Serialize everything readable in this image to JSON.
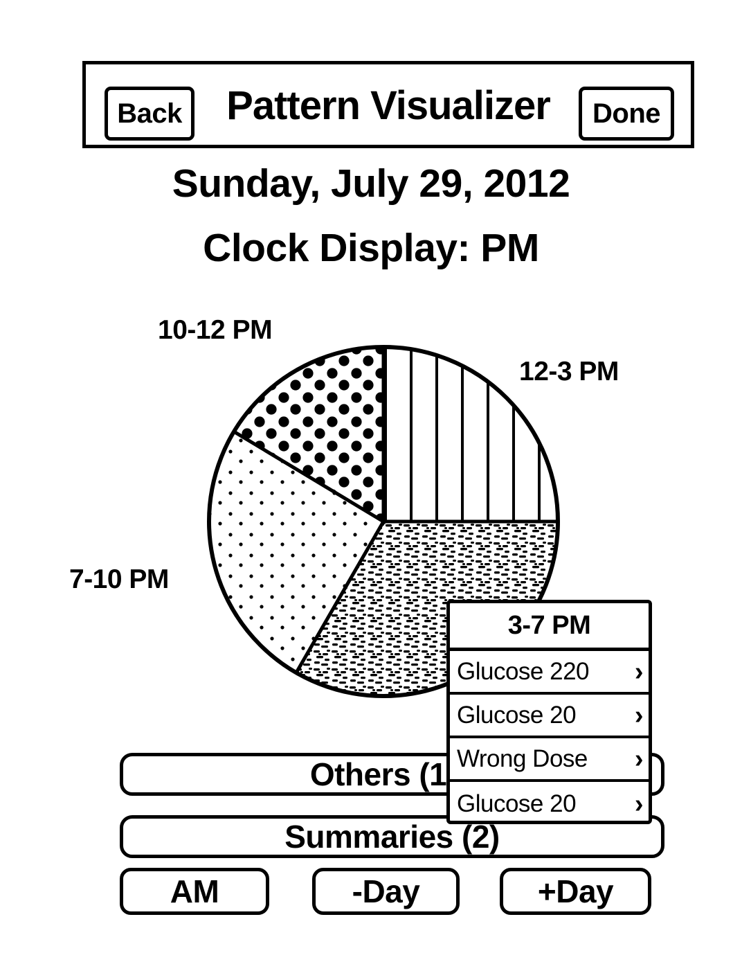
{
  "nav": {
    "back_label": "Back",
    "title": "Pattern Visualizer",
    "done_label": "Done"
  },
  "heading": {
    "date": "Sunday, July 29, 2012",
    "clock_display": "Clock Display: PM"
  },
  "chart_data": {
    "type": "pie",
    "title": "",
    "categories": [
      "12-3 PM",
      "3-7 PM",
      "7-10 PM",
      "10-12 PM"
    ],
    "values": [
      3,
      4,
      3,
      2
    ],
    "units": "hours",
    "slices": [
      {
        "label": "12-3 PM",
        "hours": 3,
        "start_deg": 0,
        "end_deg": 90,
        "fill": "vertical-lines"
      },
      {
        "label": "3-7 PM",
        "hours": 4,
        "start_deg": 90,
        "end_deg": 210,
        "fill": "dense-speckle"
      },
      {
        "label": "7-10 PM",
        "hours": 3,
        "start_deg": 210,
        "end_deg": 301,
        "fill": "fine-dots"
      },
      {
        "label": "10-12 PM",
        "hours": 2,
        "start_deg": 301,
        "end_deg": 360,
        "fill": "bold-dots"
      }
    ],
    "legend_position": "around-pie",
    "grid": false
  },
  "pie_labels": {
    "top_left": "10-12 PM",
    "top_right": "12-3 PM",
    "left": "7-10 PM"
  },
  "popup": {
    "title": "3-7 PM",
    "rows": [
      {
        "label": "Glucose 220",
        "chevron": "›"
      },
      {
        "label": "Glucose 20",
        "chevron": "›"
      },
      {
        "label": "Wrong Dose",
        "chevron": "›"
      },
      {
        "label": "Glucose 20",
        "chevron": "›"
      }
    ]
  },
  "lists": {
    "others_label": "Others (15)",
    "summaries_label": "Summaries (2)"
  },
  "footer": {
    "am_label": "AM",
    "minus_day_label": "-Day",
    "plus_day_label": "+Day"
  },
  "colors": {
    "ink": "#000000",
    "paper": "#ffffff"
  }
}
